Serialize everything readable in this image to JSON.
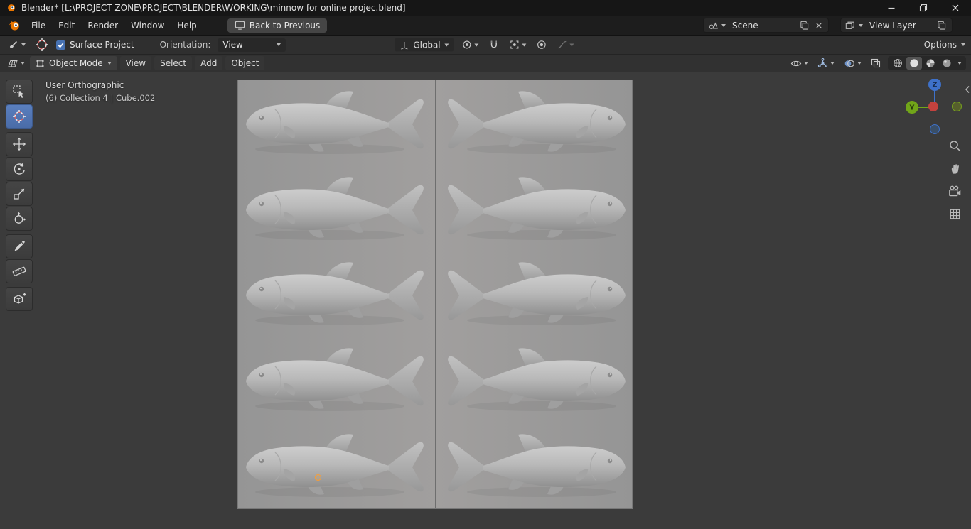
{
  "window": {
    "title": "Blender* [L:\\PROJECT ZONE\\PROJECT\\BLENDER\\WORKING\\minnow for online projec.blend]"
  },
  "menubar": {
    "menus": [
      {
        "label": "File"
      },
      {
        "label": "Edit"
      },
      {
        "label": "Render"
      },
      {
        "label": "Window"
      },
      {
        "label": "Help"
      }
    ],
    "back_button_label": "Back to Previous",
    "scene_selector": {
      "value": "Scene"
    },
    "view_layer_selector": {
      "value": "View Layer"
    }
  },
  "tool_settings": {
    "surface_project": {
      "label": "Surface Project",
      "checked": true
    },
    "orientation": {
      "label": "Orientation:",
      "value": "View"
    },
    "transform_orientation": {
      "value": "Global"
    },
    "options_label": "Options"
  },
  "viewport_header": {
    "mode": "Object Mode",
    "menus": [
      {
        "label": "View"
      },
      {
        "label": "Select"
      },
      {
        "label": "Add"
      },
      {
        "label": "Object"
      }
    ]
  },
  "viewport": {
    "view_label": "User Orthographic",
    "context_label": "(6) Collection 4 | Cube.002",
    "scene_objects": {
      "description": "gray minnow fish models on two mirrored ground planes, solid shading",
      "rows": 5,
      "columns": 2,
      "mirrored_columns": true
    }
  },
  "toolbar_tools": [
    {
      "name": "select-box",
      "active": false
    },
    {
      "name": "cursor",
      "active": true
    },
    {
      "name": "move",
      "active": false
    },
    {
      "name": "rotate",
      "active": false
    },
    {
      "name": "scale",
      "active": false
    },
    {
      "name": "transform",
      "active": false
    },
    {
      "name": "annotate",
      "active": false
    },
    {
      "name": "measure",
      "active": false
    },
    {
      "name": "add-cube",
      "active": false
    }
  ],
  "nav_gizmo": {
    "z_label": "Z",
    "y_label": "Y"
  },
  "colors": {
    "accent_blue": "#4772b3",
    "axis_x_red": "#c4423e",
    "axis_y_green": "#71a519",
    "axis_z_blue": "#3e71c9",
    "viewport_bg": "#3b3b3b",
    "plane_gray": "#9d9d9d",
    "origin_orange": "#ff9d2e",
    "blender_orange": "#ea7600"
  }
}
